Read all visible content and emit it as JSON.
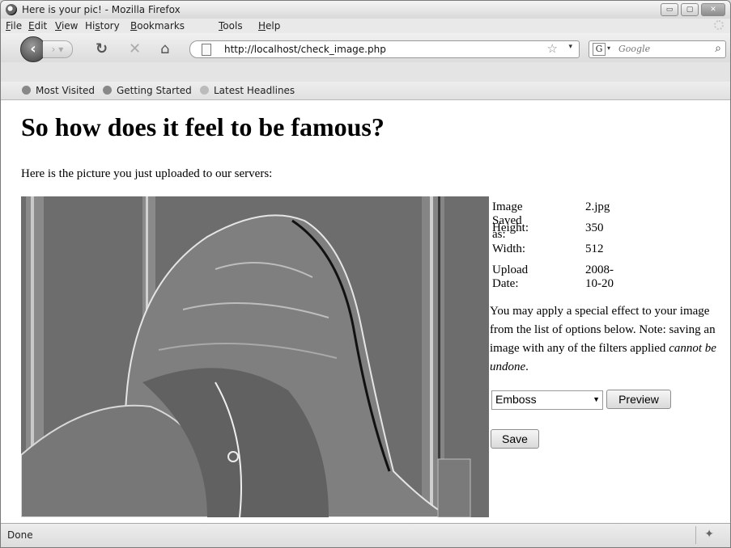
{
  "window": {
    "title": "Here is your pic! - Mozilla Firefox",
    "minimize": "▭",
    "maximize": "▢",
    "close": "✕"
  },
  "menu": {
    "items": [
      {
        "pre": "",
        "key": "F",
        "post": "ile"
      },
      {
        "pre": "",
        "key": "E",
        "post": "dit"
      },
      {
        "pre": "",
        "key": "V",
        "post": "iew"
      },
      {
        "pre": "Hi",
        "key": "s",
        "post": "tory"
      },
      {
        "pre": "",
        "key": "B",
        "post": "ookmarks"
      },
      {
        "pre": "",
        "key": "T",
        "post": "ools"
      },
      {
        "pre": "",
        "key": "H",
        "post": "elp"
      }
    ]
  },
  "navbar": {
    "url": "http://localhost/check_image.php",
    "search_placeholder": "Google",
    "icons": [
      "back-arrow-icon",
      "forward-arrow-icon",
      "reload-icon",
      "stop-icon",
      "home-icon",
      "page-icon",
      "star-icon",
      "search-engine-icon",
      "magnifier-icon"
    ]
  },
  "bookmarks": {
    "items": [
      "Most Visited",
      "Getting Started",
      "Latest Headlines"
    ]
  },
  "page": {
    "heading": "So how does it feel to be famous?",
    "intro": "Here is the picture you just uploaded to our servers:",
    "info": [
      {
        "label": "Image Saved as:",
        "value": "2.jpg"
      },
      {
        "label": "Height:",
        "value": "350"
      },
      {
        "label": "Width:",
        "value": "512"
      },
      {
        "label": "Upload Date:",
        "value": "2008-10-20"
      }
    ],
    "note_text": "You may apply a special effect to your image from the list of options below. Note: saving an image with any of the filters applied ",
    "note_emphasis": "cannot be undone",
    "note_end": ".",
    "filter_selected": "Emboss",
    "preview_label": "Preview",
    "save_label": "Save"
  },
  "status": {
    "text": "Done"
  }
}
